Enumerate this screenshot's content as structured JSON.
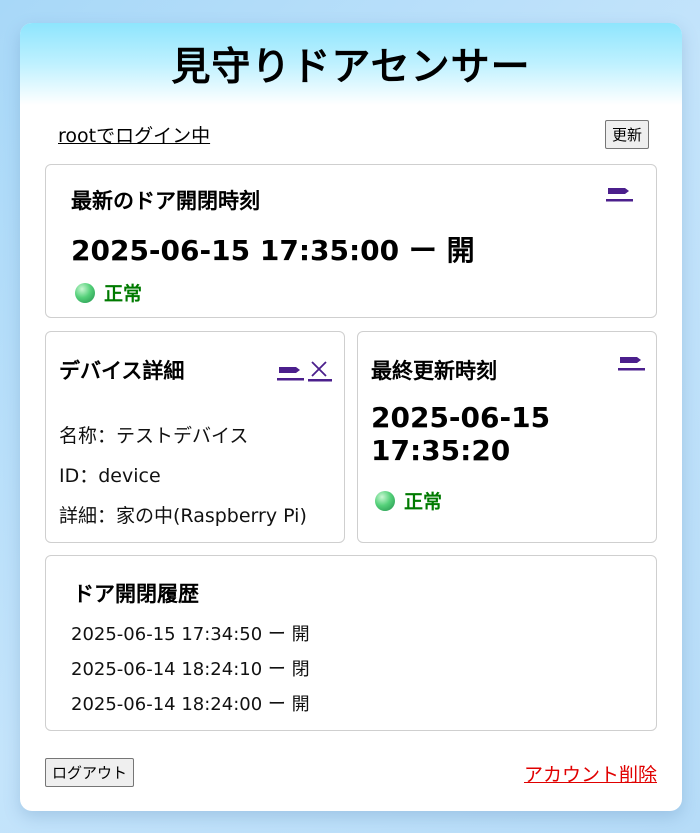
{
  "app": {
    "title": "見守りドアセンサー"
  },
  "session": {
    "login_text": "rootでログイン中",
    "refresh_label": "更新"
  },
  "latest": {
    "title": "最新のドア開閉時刻",
    "value": "2025-06-15 17:35:00 ー 開",
    "status": "正常"
  },
  "device": {
    "title": "デバイス詳細",
    "name_line": "名称：テストデバイス",
    "id_line": "ID：device",
    "detail_line": "詳細：家の中(Raspberry Pi)"
  },
  "updated": {
    "title": "最終更新時刻",
    "date": "2025-06-15",
    "time": "17:35:20",
    "status": "正常"
  },
  "history": {
    "title": "ドア開閉履歴",
    "entries": [
      "2025-06-15 17:34:50 ー 開",
      "2025-06-14 18:24:10 ー 閉",
      "2025-06-14 18:24:00 ー 開"
    ]
  },
  "footer": {
    "logout_label": "ログアウト",
    "delete_label": "アカウント削除"
  },
  "colors": {
    "accent": "#4b1f8c",
    "ok": "#007a00",
    "danger": "#e00000",
    "header": "#8ee5fd"
  },
  "icons": {
    "edit": "pen-icon",
    "delete": "close-icon",
    "status": "green-dot-icon"
  }
}
